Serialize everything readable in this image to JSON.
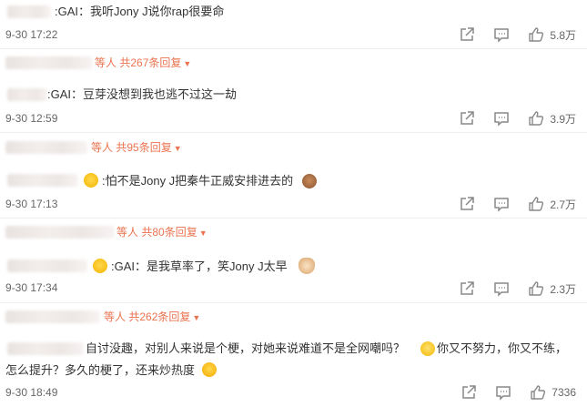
{
  "comments": [
    {
      "text": ":GAI：我听Jony J说你rap很要命",
      "time": "9-30 17:22",
      "like_count": "5.8万",
      "reply_people": "等人",
      "reply_count": "共267条回复"
    },
    {
      "text": ":GAI：豆芽没想到我也逃不过这一劫",
      "time": "9-30 12:59",
      "like_count": "3.9万",
      "reply_people": "等人",
      "reply_count": "共95条回复"
    },
    {
      "text": ":怕不是Jony J把秦牛正威安排进去的",
      "time": "9-30 17:13",
      "like_count": "2.7万",
      "reply_people": "等人",
      "reply_count": "共80条回复"
    },
    {
      "text": ":GAI：是我草率了，笑Jony J太早",
      "time": "9-30 17:34",
      "like_count": "2.3万",
      "reply_people": "等人",
      "reply_count": "共262条回复"
    },
    {
      "text_line1": "自讨没趣，对别人来说是个梗，对她来说难道不是全网嘲吗？",
      "text_line1b": "你又不努力，你又不练，",
      "text_line2": "怎么提升？多久的梗了，还来炒热度",
      "time": "9-30 18:49",
      "like_count": "7336"
    }
  ],
  "colors": {
    "accent": "#eb7350",
    "text": "#333333",
    "muted": "#666666"
  },
  "icons": [
    "share-icon",
    "comment-icon",
    "like-icon",
    "emoji-icon"
  ]
}
